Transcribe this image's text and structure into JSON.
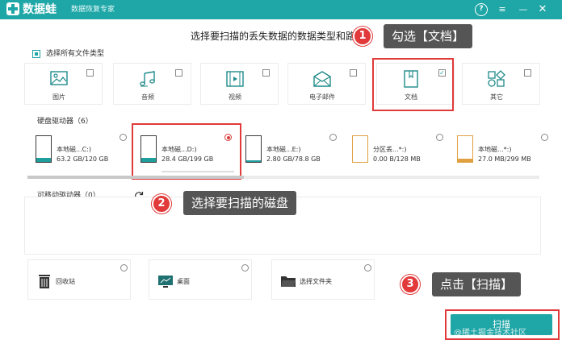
{
  "app": {
    "name": "数据蛙",
    "subtitle": "数据恢复专家",
    "help_label": "?",
    "menu_label": "≡",
    "minimize_label": "—",
    "close_label": "✕"
  },
  "heading": "选择要扫描的丢失数据的数据类型和路",
  "select_all_label": "选择所有文件类型",
  "file_types": [
    {
      "label": "图片",
      "icon": "image-icon",
      "checked": false
    },
    {
      "label": "音频",
      "icon": "music-icon",
      "checked": false
    },
    {
      "label": "视频",
      "icon": "video-icon",
      "checked": false
    },
    {
      "label": "电子邮件",
      "icon": "email-icon",
      "checked": false
    },
    {
      "label": "文档",
      "icon": "document-icon",
      "checked": true,
      "check_mark": "✓"
    },
    {
      "label": "其它",
      "icon": "other-icon",
      "checked": false
    }
  ],
  "hard_drives": {
    "title": "硬盘驱动器（6）",
    "items": [
      {
        "name": "本地磁...C:)",
        "size": "63.2 GB/120 GB",
        "selected": false,
        "color": "#1f9e9e",
        "used_fraction": 0.53
      },
      {
        "name": "本地磁...D:)",
        "size": "28.4 GB/199 GB",
        "selected": true,
        "color": "#1f9e9e",
        "used_fraction": 0.14
      },
      {
        "name": "本地磁...E:)",
        "size": "2.80 GB/78.8 GB",
        "selected": false,
        "color": "#1f9e9e",
        "used_fraction": 0.04
      },
      {
        "name": "分区丢...*:)",
        "size": "0.00  B/128 MB",
        "selected": false,
        "color": "#e0a040",
        "used_fraction": 0.0
      },
      {
        "name": "本地磁...*:)",
        "size": "27.0 MB/299 MB",
        "selected": false,
        "color": "#e0a040",
        "used_fraction": 0.09
      }
    ]
  },
  "removable": {
    "title": "可移动驱动器（0）"
  },
  "locations": [
    {
      "label": "回收站",
      "icon": "recycle-bin-icon"
    },
    {
      "label": "桌面",
      "icon": "desktop-icon"
    },
    {
      "label": "选择文件夹",
      "icon": "folder-icon"
    }
  ],
  "scan_button_label": "扫描",
  "watermark": "@稀土掘金技术社区",
  "callouts": [
    {
      "number": "1",
      "text": "勾选【文档】"
    },
    {
      "number": "2",
      "text": "选择要扫描的磁盘"
    },
    {
      "number": "3",
      "text": "点击【扫描】"
    }
  ],
  "colors": {
    "brand": "#1fa6a6",
    "highlight": "#e03a3a",
    "callout_bg": "#555555"
  }
}
